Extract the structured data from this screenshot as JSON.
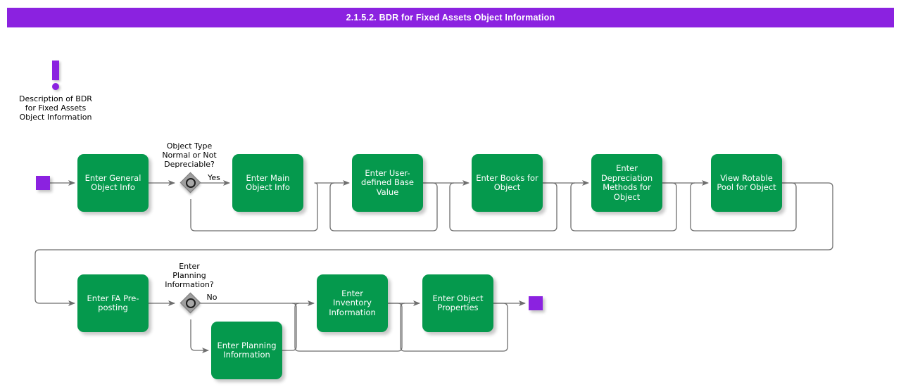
{
  "title": {
    "text": "2.1.5.2. BDR for Fixed Assets Object Information",
    "background": "#8b22e0",
    "color": "#ffffff"
  },
  "note": {
    "icon": "exclamation-mark-icon",
    "text": "Description of BDR\nfor Fixed Assets\nObject Information"
  },
  "colors": {
    "task_fill": "#05994d",
    "task_text": "#ffffff",
    "terminator_fill": "#8b22e0",
    "gateway_fill": "#9e9e9e",
    "connector": "#6e6e6e"
  },
  "terminators": [
    {
      "name": "start-event",
      "label": ""
    },
    {
      "name": "end-event",
      "label": ""
    }
  ],
  "tasks": [
    {
      "id": "t1",
      "label": "Enter General\nObject Info"
    },
    {
      "id": "t2",
      "label": "Enter Main\nObject Info"
    },
    {
      "id": "t3",
      "label": "Enter User-\ndefined Base\nValue"
    },
    {
      "id": "t4",
      "label": "Enter Books for\nObject"
    },
    {
      "id": "t5",
      "label": "Enter\nDepreciation\nMethods for\nObject"
    },
    {
      "id": "t6",
      "label": "View Rotable\nPool for Object"
    },
    {
      "id": "t7",
      "label": "Enter FA Pre-\nposting"
    },
    {
      "id": "t8",
      "label": "Enter Planning\nInformation"
    },
    {
      "id": "t9",
      "label": "Enter Inventory\nInformation"
    },
    {
      "id": "t10",
      "label": "Enter Object\nProperties"
    }
  ],
  "gateways": [
    {
      "id": "g1",
      "question": "Object Type\nNormal or Not\nDepreciable?",
      "branch_label": "Yes"
    },
    {
      "id": "g2",
      "question": "Enter\nPlanning\nInformation?",
      "branch_label": "No"
    }
  ]
}
